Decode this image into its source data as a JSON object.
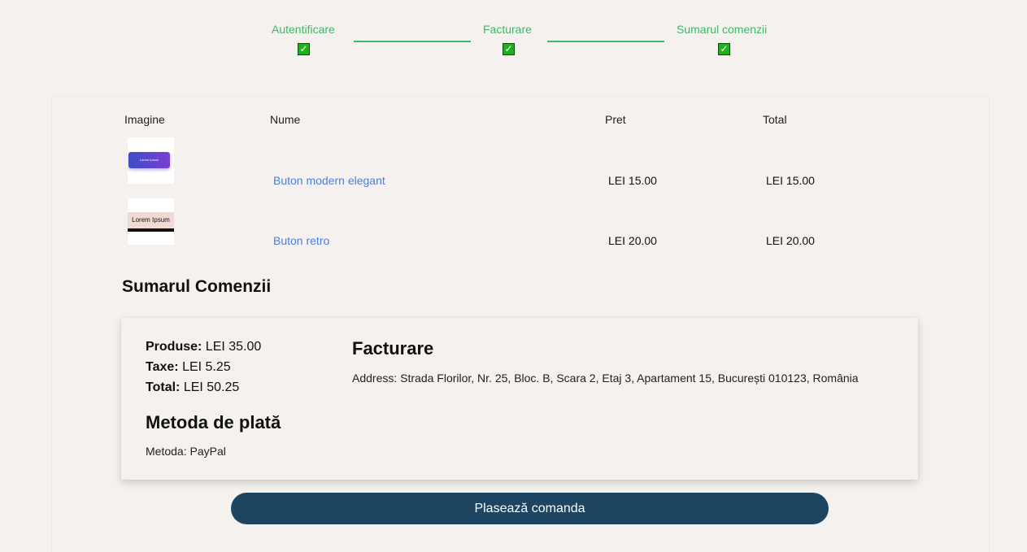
{
  "stepper": {
    "steps": [
      {
        "label": "Autentificare"
      },
      {
        "label": "Facturare"
      },
      {
        "label": "Sumarul comenzii"
      }
    ],
    "check_glyph": "✓"
  },
  "table": {
    "headers": {
      "image": "Imagine",
      "name": "Nume",
      "price": "Pret",
      "total": "Total"
    },
    "rows": [
      {
        "thumb_text": "Lorem Ipsum",
        "name": "Buton modern elegant",
        "price": "LEI 15.00",
        "total": "LEI 15.00"
      },
      {
        "thumb_text": "Lorem Ipsum",
        "name": "Buton retro",
        "price": "LEI 20.00",
        "total": "LEI 20.00"
      }
    ]
  },
  "summary": {
    "title": "Sumarul Comenzii",
    "products_label": "Produse:",
    "products_value": "LEI 35.00",
    "taxes_label": "Taxe:",
    "taxes_value": "LEI 5.25",
    "total_label": "Total:",
    "total_value": "LEI 50.25",
    "payment_title": "Metoda de plată",
    "payment_method": "Metoda: PayPal",
    "billing_title": "Facturare",
    "address": "Address: Strada Florilor, Nr. 25, Bloc. B, Scara 2, Etaj 3, Apartament 15, București 010123, România"
  },
  "actions": {
    "place_order": "Plasează comanda"
  },
  "colors": {
    "accent_green": "#3fb868",
    "link_blue": "#4d7fd8",
    "button_navy": "#1d4461"
  }
}
